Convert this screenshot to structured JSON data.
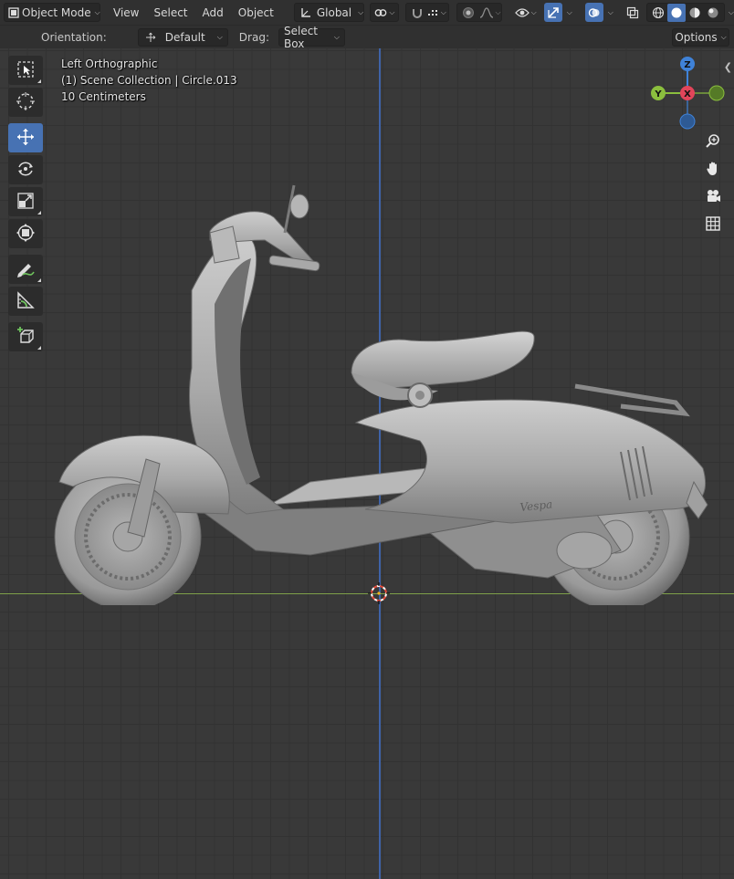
{
  "header": {
    "mode": "Object Mode",
    "menus": [
      "View",
      "Select",
      "Add",
      "Object"
    ],
    "transform_orientation": "Global"
  },
  "tool_settings": {
    "orientation_label": "Orientation:",
    "orientation_value": "Default",
    "drag_label": "Drag:",
    "drag_value": "Select Box",
    "options_label": "Options"
  },
  "viewport": {
    "view_name": "Left Orthographic",
    "collection_info": "(1) Scene Collection | Circle.013",
    "grid_scale": "10 Centimeters",
    "logo_text": "Vespa"
  },
  "gizmo": {
    "z_label": "Z",
    "y_label": "Y",
    "x_label": "X"
  },
  "colors": {
    "accent": "#4772b3",
    "axis_x": "#e2455a",
    "axis_y": "#8bbf3e",
    "axis_z": "#3f82d8",
    "grid_bg": "#393939",
    "header_bg": "#303030"
  }
}
